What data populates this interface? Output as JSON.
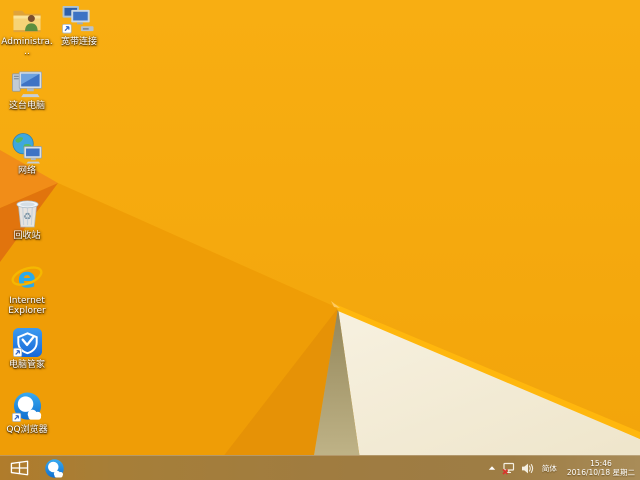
{
  "desktop": {
    "icons": [
      {
        "name": "administrator-folder",
        "label": "Administra..."
      },
      {
        "name": "broadband-connection",
        "label": "宽带连接"
      },
      {
        "name": "this-pc",
        "label": "这台电脑"
      },
      {
        "name": "network",
        "label": "网络"
      },
      {
        "name": "recycle-bin",
        "label": "回收站"
      },
      {
        "name": "internet-explorer",
        "label": "Internet Explorer"
      },
      {
        "name": "pc-manager",
        "label": "电脑管家"
      },
      {
        "name": "qq-browser",
        "label": "QQ浏览器"
      }
    ]
  },
  "taskbar": {
    "icons": [
      {
        "name": "start-button"
      },
      {
        "name": "qq-browser-taskbar-icon"
      }
    ],
    "tray": {
      "icons": [
        "chevron-up-icon",
        "network-disconnected-icon",
        "volume-icon"
      ],
      "language": "简体",
      "time": "15:46",
      "date": "2016/10/18 星期二"
    }
  },
  "wallpaper": {
    "description": "Windows 8.1 default orange folded-paper wallpaper",
    "base_orange": "#F5A90C",
    "fold_dark_orange": "#E1740D",
    "lower_fold_orange": "#EF9D06",
    "edge_highlight": "#FFB70D",
    "cream_panel": "#F2EAD4",
    "khaki_shadow": "#AC9F70",
    "taskbar_tan": "#A07D41"
  }
}
